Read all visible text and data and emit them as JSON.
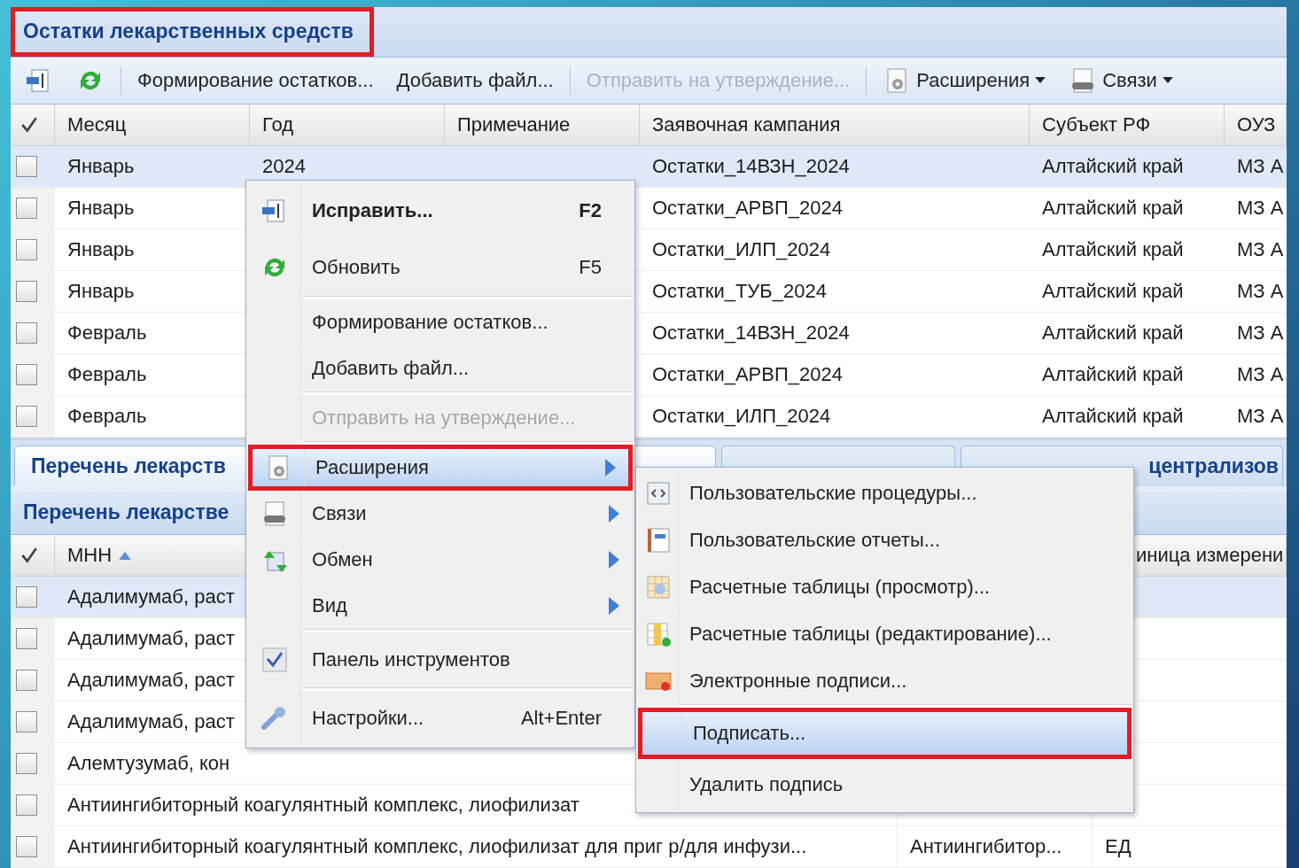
{
  "title": {
    "text": "Остатки лекарственных средств",
    "highlighted": true
  },
  "toolbar": [
    {
      "kind": "icon"
    },
    {
      "kind": "icon"
    },
    {
      "kind": "separator"
    },
    {
      "kind": "button",
      "label": "Формирование остатков...",
      "disabled": false
    },
    {
      "kind": "button",
      "label": "Добавить файл...",
      "disabled": false
    },
    {
      "kind": "separator"
    },
    {
      "kind": "button",
      "label": "Отправить на утверждение...",
      "disabled": true
    },
    {
      "kind": "separator"
    },
    {
      "kind": "menu",
      "label": "Расширения",
      "disabled": false
    },
    {
      "kind": "menu",
      "label": "Связи",
      "disabled": false
    }
  ],
  "top_grid": {
    "columns": [
      "Месяц",
      "Год",
      "Примечание",
      "Заявочная кампания",
      "Субъект РФ",
      "ОУЗ"
    ],
    "rows": [
      {
        "checked": false,
        "selected": true,
        "month": "Январь",
        "year": "2024",
        "campaign": "Остатки_14ВЗН_2024",
        "subject": "Алтайский край",
        "ouz": "МЗ А"
      },
      {
        "checked": false,
        "selected": false,
        "month": "Январь",
        "campaign": "Остатки_АРВП_2024",
        "subject": "Алтайский край",
        "ouz": "МЗ А"
      },
      {
        "checked": false,
        "selected": false,
        "month": "Январь",
        "campaign": "Остатки_ИЛП_2024",
        "subject": "Алтайский край",
        "ouz": "МЗ А"
      },
      {
        "checked": false,
        "selected": false,
        "month": "Январь",
        "campaign": "Остатки_ТУБ_2024",
        "subject": "Алтайский край",
        "ouz": "МЗ А"
      },
      {
        "checked": false,
        "selected": false,
        "month": "Февраль",
        "campaign": "Остатки_14ВЗН_2024",
        "subject": "Алтайский край",
        "ouz": "МЗ А"
      },
      {
        "checked": false,
        "selected": false,
        "month": "Февраль",
        "campaign": "Остатки_АРВП_2024",
        "subject": "Алтайский край",
        "ouz": "МЗ А"
      },
      {
        "checked": false,
        "selected": false,
        "month": "Февраль",
        "campaign": "Остатки_ИЛП_2024",
        "subject": "Алтайский край",
        "ouz": "МЗ А"
      }
    ]
  },
  "tabs": [
    {
      "label": "Перечень лекарств",
      "selected": true
    },
    {
      "selected": false
    },
    {
      "label": "централизов",
      "selected": false
    }
  ],
  "bottom_panel": {
    "title": "Перечень лекарстве"
  },
  "bottom_grid": {
    "columns": {
      "mnn": {
        "label": "МНН",
        "sorted": true
      },
      "unit": {
        "label": "иница измерени"
      }
    },
    "rows": [
      {
        "checked": false,
        "selected": true,
        "mnn": "Адалимумаб, раст"
      },
      {
        "checked": false,
        "selected": false,
        "mnn": "Адалимумаб, раст"
      },
      {
        "checked": false,
        "selected": false,
        "mnn": "Адалимумаб, раст"
      },
      {
        "checked": false,
        "selected": false,
        "mnn": "Адалимумаб, раст"
      },
      {
        "checked": false,
        "selected": false,
        "mnn": "Алемтузумаб, кон"
      },
      {
        "checked": false,
        "selected": false,
        "mnn": "Антиингибиторный коагулянтный комплекс, лиофилизат"
      },
      {
        "checked": false,
        "selected": false,
        "mnn": "Антиингибиторный коагулянтный комплекс, лиофилизат для приг р/для инфузи...",
        "column_2": "Антиингибитор...",
        "unit": "ЕД"
      }
    ]
  },
  "context_menu": [
    {
      "kind": "item",
      "label": "Исправить...",
      "shortcut": "F2",
      "default": true,
      "disabled": false,
      "active": false,
      "highlighted": false
    },
    {
      "kind": "item",
      "label": "Обновить",
      "shortcut": "F5",
      "default": false,
      "disabled": false,
      "active": false,
      "highlighted": false
    },
    {
      "kind": "separator"
    },
    {
      "kind": "item",
      "label": "Формирование остатков...",
      "default": false,
      "disabled": false,
      "active": false,
      "highlighted": false
    },
    {
      "kind": "item",
      "label": "Добавить файл...",
      "default": false,
      "disabled": false,
      "active": false,
      "highlighted": false
    },
    {
      "kind": "separator"
    },
    {
      "kind": "item",
      "label": "Отправить на утверждение...",
      "default": false,
      "disabled": true,
      "active": false,
      "highlighted": false
    },
    {
      "kind": "separator"
    },
    {
      "kind": "submenu",
      "label": "Расширения",
      "default": false,
      "disabled": false,
      "active": true,
      "highlighted": true
    },
    {
      "kind": "submenu",
      "label": "Связи",
      "default": false,
      "disabled": false,
      "active": false,
      "highlighted": false
    },
    {
      "kind": "submenu",
      "label": "Обмен",
      "default": false,
      "disabled": false,
      "active": false,
      "highlighted": false
    },
    {
      "kind": "submenu",
      "label": "Вид",
      "default": false,
      "disabled": false,
      "active": false,
      "highlighted": false
    },
    {
      "kind": "separator"
    },
    {
      "kind": "check",
      "label": "Панель инструментов",
      "checked": true,
      "default": false,
      "disabled": false,
      "active": false,
      "highlighted": false
    },
    {
      "kind": "separator"
    },
    {
      "kind": "item",
      "label": "Настройки...",
      "shortcut": "Alt+Enter",
      "default": false,
      "disabled": false,
      "active": false,
      "highlighted": false
    }
  ],
  "submenu": [
    {
      "kind": "item",
      "label": "Пользовательские процедуры...",
      "active": false,
      "highlighted": false
    },
    {
      "kind": "item",
      "label": "Пользовательские отчеты...",
      "active": false,
      "highlighted": false
    },
    {
      "kind": "item",
      "label": "Расчетные таблицы (просмотр)...",
      "active": false,
      "highlighted": false
    },
    {
      "kind": "item",
      "label": "Расчетные таблицы (редактирование)...",
      "active": false,
      "highlighted": false
    },
    {
      "kind": "item",
      "label": "Электронные подписи...",
      "active": false,
      "highlighted": false
    },
    {
      "kind": "separator"
    },
    {
      "kind": "item",
      "label": "Подписать...",
      "active": true,
      "highlighted": true
    },
    {
      "kind": "item",
      "label": "Удалить подпись",
      "active": false,
      "highlighted": false
    }
  ]
}
